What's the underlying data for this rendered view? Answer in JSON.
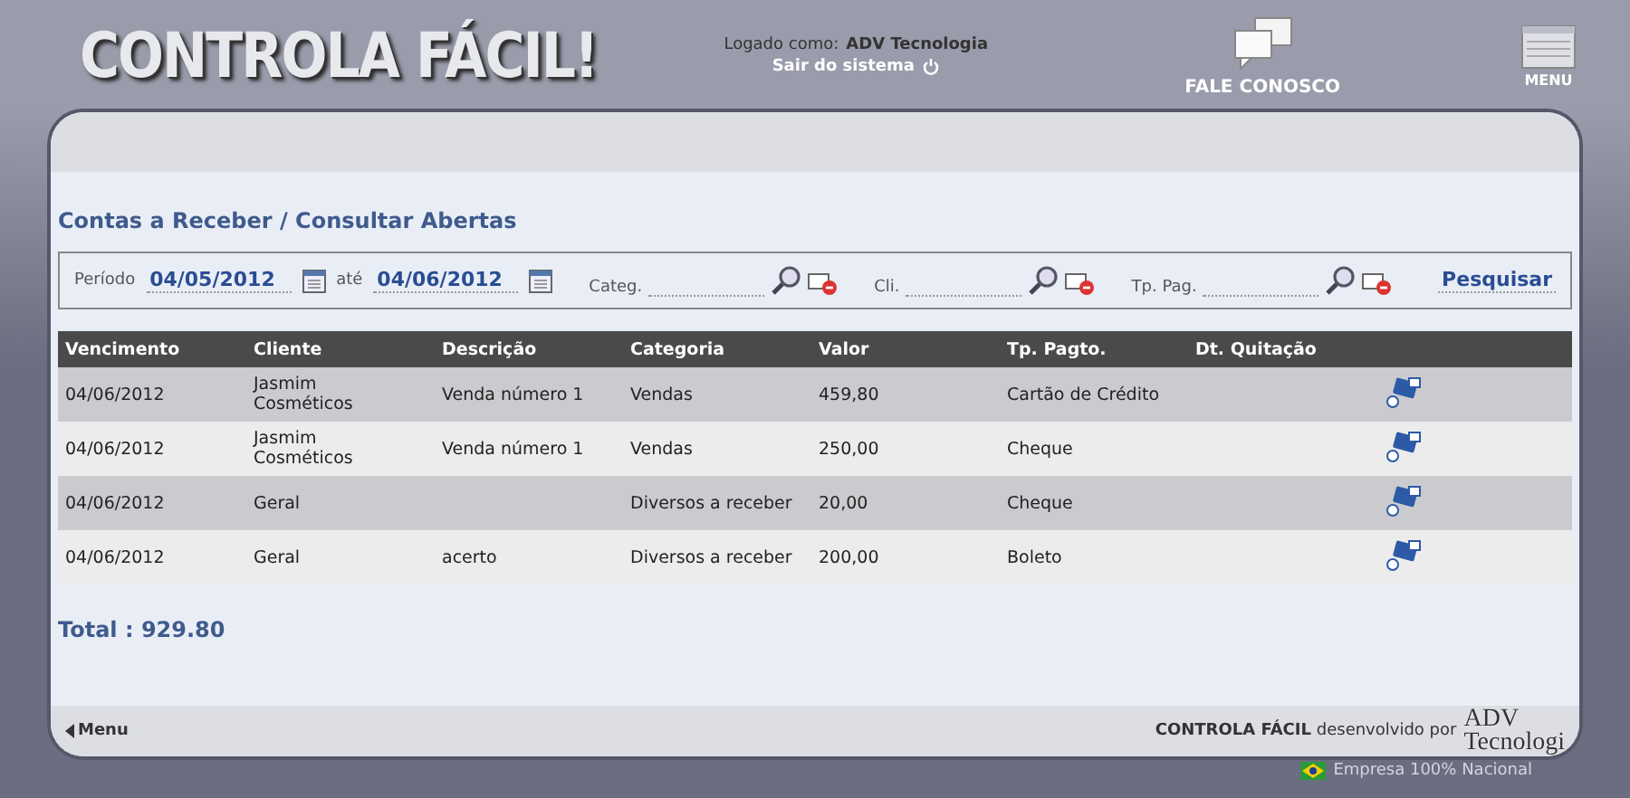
{
  "header": {
    "logo": "CONTROLA FÁCIL!",
    "login_label": "Logado como:",
    "login_user": "ADV Tecnologia",
    "logout": "Sair do sistema",
    "contact": "FALE CONOSCO",
    "menu": "MENU"
  },
  "page_title": "Contas a Receber / Consultar Abertas",
  "filters": {
    "period_label": "Período",
    "date_from": "04/05/2012",
    "until_label": "até",
    "date_to": "04/06/2012",
    "lookups": [
      {
        "label": "Categ."
      },
      {
        "label": "Cli."
      },
      {
        "label": "Tp. Pag."
      }
    ],
    "search_button": "Pesquisar"
  },
  "table": {
    "columns": [
      "Vencimento",
      "Cliente",
      "Descrição",
      "Categoria",
      "Valor",
      "Tp. Pagto.",
      "Dt. Quitação"
    ],
    "rows": [
      {
        "cells": [
          "04/06/2012",
          "Jasmim Cosméticos",
          "Venda número 1",
          "Vendas",
          "459,80",
          "Cartão de Crédito",
          ""
        ]
      },
      {
        "cells": [
          "04/06/2012",
          "Jasmim Cosméticos",
          "Venda número 1",
          "Vendas",
          "250,00",
          "Cheque",
          ""
        ]
      },
      {
        "cells": [
          "04/06/2012",
          "Geral",
          "",
          "Diversos a receber",
          "20,00",
          "Cheque",
          ""
        ]
      },
      {
        "cells": [
          "04/06/2012",
          "Geral",
          "acerto",
          "Diversos a receber",
          "200,00",
          "Boleto",
          ""
        ]
      }
    ]
  },
  "total": "Total : 929.80",
  "footer": {
    "back": "Menu",
    "brand": "CONTROLA FÁCIL",
    "credit": "desenvolvido por",
    "logo_line1": "ADV",
    "logo_line2": "Tecnologi",
    "national": "Empresa 100% Nacional"
  }
}
